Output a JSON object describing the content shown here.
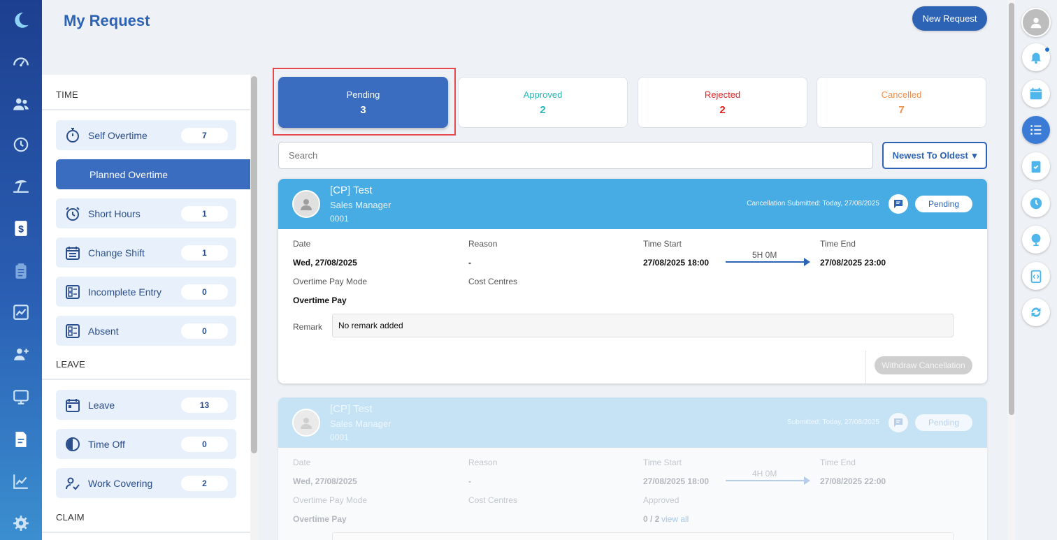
{
  "page": {
    "title": "My Request",
    "new_request_label": "New Request"
  },
  "sections": {
    "time": "TIME",
    "leave": "LEAVE",
    "claim": "CLAIM"
  },
  "categories": [
    {
      "label": "Self Overtime",
      "count": "7"
    },
    {
      "label": "Planned Overtime",
      "count": ""
    },
    {
      "label": "Short Hours",
      "count": "1"
    },
    {
      "label": "Change Shift",
      "count": "1"
    },
    {
      "label": "Incomplete Entry",
      "count": "0"
    },
    {
      "label": "Absent",
      "count": "0"
    },
    {
      "label": "Leave",
      "count": "13"
    },
    {
      "label": "Time Off",
      "count": "0"
    },
    {
      "label": "Work Covering",
      "count": "2"
    }
  ],
  "status_tabs": [
    {
      "label": "Pending",
      "count": "3",
      "color": "#ffffff"
    },
    {
      "label": "Approved",
      "count": "2",
      "color": "#27b8b8"
    },
    {
      "label": "Rejected",
      "count": "2",
      "color": "#e02424"
    },
    {
      "label": "Cancelled",
      "count": "7",
      "color": "#f0904a"
    }
  ],
  "search": {
    "placeholder": "Search"
  },
  "sort": {
    "label": "Newest To Oldest"
  },
  "requests": [
    {
      "name": "[CP] Test",
      "position": "Sales Manager",
      "id": "0001",
      "submitted": "Cancellation Submitted: Today, 27/08/2025",
      "status": "Pending",
      "labels": {
        "date": "Date",
        "reason": "Reason",
        "time_start": "Time Start",
        "time_end": "Time End",
        "pay_mode": "Overtime Pay Mode",
        "cost_centres": "Cost Centres",
        "remark": "Remark"
      },
      "date": "Wed, 27/08/2025",
      "reason": "-",
      "time_start": "27/08/2025 18:00",
      "duration": "5H 0M",
      "time_end": "27/08/2025 23:00",
      "pay_mode": "Overtime Pay",
      "remark": "No remark added",
      "action_label": "Withdraw Cancellation"
    },
    {
      "name": "[CP] Test",
      "position": "Sales Manager",
      "id": "0001",
      "submitted": "Submitted: Today, 27/08/2025",
      "status": "Pending",
      "labels": {
        "date": "Date",
        "reason": "Reason",
        "time_start": "Time Start",
        "time_end": "Time End",
        "pay_mode": "Overtime Pay Mode",
        "cost_centres": "Cost Centres",
        "approved": "Approved"
      },
      "date": "Wed, 27/08/2025",
      "reason": "-",
      "time_start": "27/08/2025 18:00",
      "duration": "4H 0M",
      "time_end": "27/08/2025 22:00",
      "pay_mode": "Overtime Pay",
      "approved_count": "0 / 2",
      "view_all": "view all"
    }
  ],
  "colors": {
    "primary": "#2d63b5",
    "header_blue": "#47abe4",
    "highlight": "#e5484d"
  }
}
